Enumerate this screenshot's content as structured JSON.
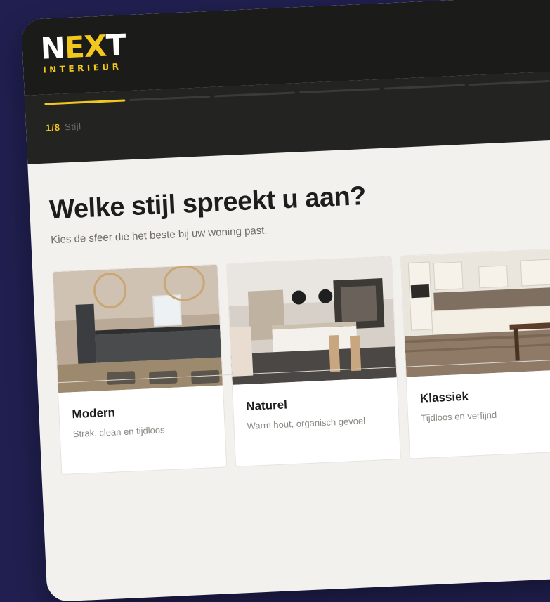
{
  "brand": {
    "logo_main": "NEXT",
    "logo_sub": "INTERIEUR",
    "accent": "#f3c81d"
  },
  "progress": {
    "current": 1,
    "total": 8,
    "label": "1/8",
    "step_name": "Stijl"
  },
  "page": {
    "title": "Welke stijl spreekt u aan?",
    "subtitle": "Kies de sfeer die het beste bij uw woning past."
  },
  "styles": [
    {
      "title": "Modern",
      "description": "Strak, clean en tijdloos",
      "image_icon": "modern-kitchen-photo"
    },
    {
      "title": "Naturel",
      "description": "Warm hout, organisch gevoel",
      "image_icon": "naturel-kitchen-photo"
    },
    {
      "title": "Klassiek",
      "description": "Tijdloos en verfijnd",
      "image_icon": "klassiek-kitchen-photo"
    }
  ]
}
